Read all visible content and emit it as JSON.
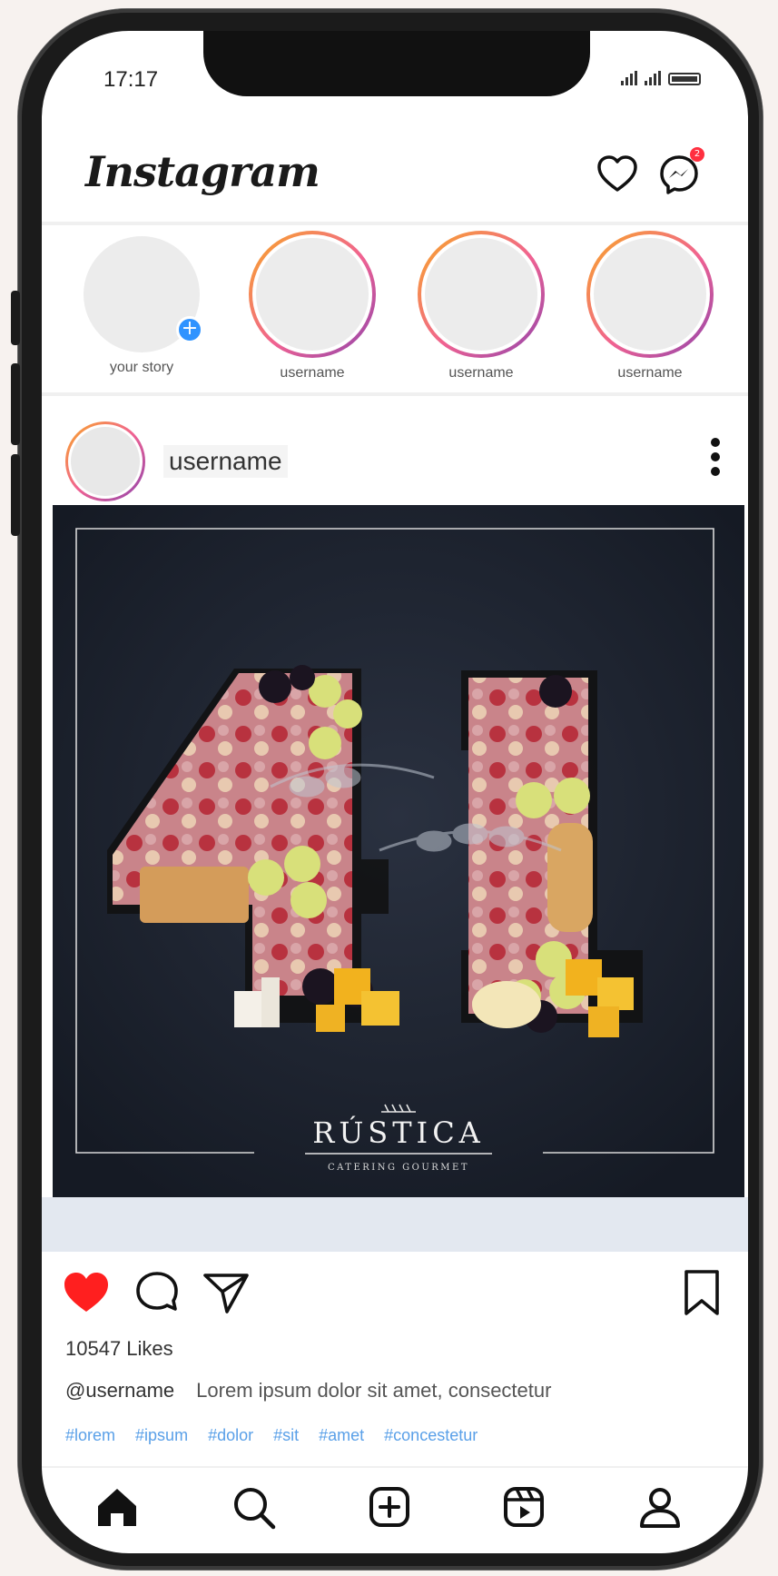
{
  "status_bar": {
    "time": "17:17"
  },
  "header": {
    "logo": "Instagram",
    "messages_badge": "2"
  },
  "stories": [
    {
      "label": "your story",
      "is_own": true
    },
    {
      "label": "username",
      "is_own": false
    },
    {
      "label": "username",
      "is_own": false
    },
    {
      "label": "username",
      "is_own": false
    }
  ],
  "post": {
    "username": "username",
    "image": {
      "brand_name": "RÚSTICA",
      "brand_tagline": "CATERING GOURMET",
      "numeral": "41",
      "background_color": "#1e2430"
    },
    "liked": true,
    "likes_text": "10547 Likes",
    "caption_user": "@username",
    "caption_text": "Lorem ipsum dolor sit amet, consectetur",
    "hashtags": [
      "#lorem",
      "#ipsum",
      "#dolor",
      "#sit",
      "#amet",
      "#concestetur"
    ]
  },
  "colors": {
    "like_red": "#ff1f1f",
    "hashtag_blue": "#5aa0e8",
    "story_gradient_start": "#f9a825",
    "story_gradient_end": "#8e44ad"
  },
  "bottom_nav": {
    "items": [
      {
        "icon": "home-icon"
      },
      {
        "icon": "search-icon"
      },
      {
        "icon": "add-post-icon"
      },
      {
        "icon": "reels-icon"
      },
      {
        "icon": "profile-icon"
      }
    ]
  }
}
